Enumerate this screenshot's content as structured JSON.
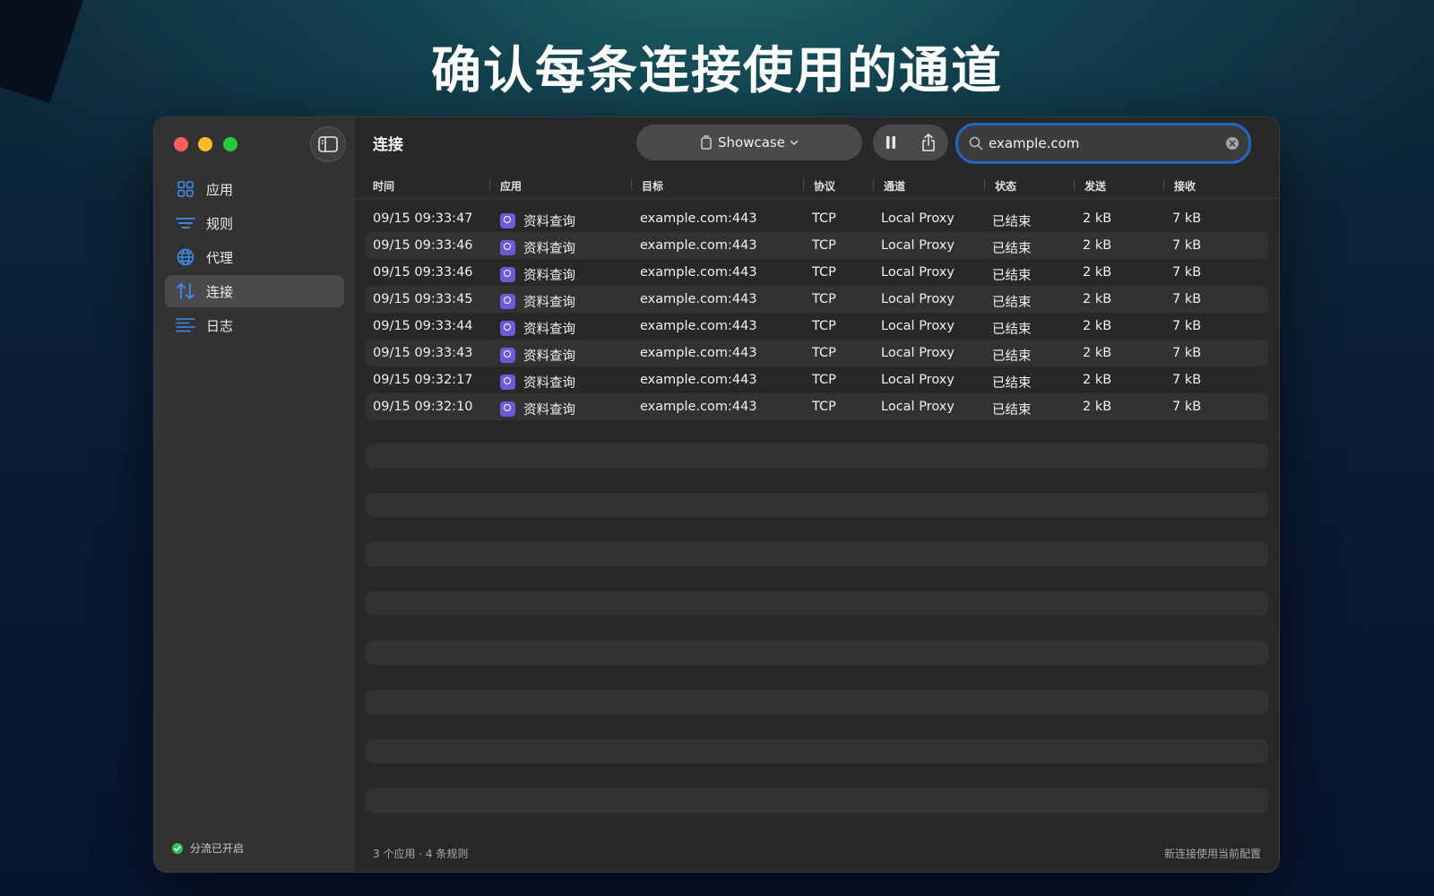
{
  "headline": "确认每条连接使用的通道",
  "sidebar": {
    "items": [
      {
        "label": "应用",
        "icon": "grid-icon"
      },
      {
        "label": "规则",
        "icon": "filter-lines-icon"
      },
      {
        "label": "代理",
        "icon": "globe-icon"
      },
      {
        "label": "连接",
        "icon": "arrows-up-down-icon",
        "active": true
      },
      {
        "label": "日志",
        "icon": "text-lines-icon"
      }
    ],
    "footer": "分流已开启"
  },
  "toolbar": {
    "title": "连接",
    "profile": "Showcase",
    "search_value": "example.com"
  },
  "table": {
    "columns": [
      "时间",
      "应用",
      "目标",
      "协议",
      "通道",
      "状态",
      "发送",
      "接收"
    ],
    "rows": [
      [
        "09/15 09:33:47",
        "资料查询",
        "example.com:443",
        "TCP",
        "Local Proxy",
        "已结束",
        "2 kB",
        "7 kB"
      ],
      [
        "09/15 09:33:46",
        "资料查询",
        "example.com:443",
        "TCP",
        "Local Proxy",
        "已结束",
        "2 kB",
        "7 kB"
      ],
      [
        "09/15 09:33:46",
        "资料查询",
        "example.com:443",
        "TCP",
        "Local Proxy",
        "已结束",
        "2 kB",
        "7 kB"
      ],
      [
        "09/15 09:33:45",
        "资料查询",
        "example.com:443",
        "TCP",
        "Local Proxy",
        "已结束",
        "2 kB",
        "7 kB"
      ],
      [
        "09/15 09:33:44",
        "资料查询",
        "example.com:443",
        "TCP",
        "Local Proxy",
        "已结束",
        "2 kB",
        "7 kB"
      ],
      [
        "09/15 09:33:43",
        "资料查询",
        "example.com:443",
        "TCP",
        "Local Proxy",
        "已结束",
        "2 kB",
        "7 kB"
      ],
      [
        "09/15 09:32:17",
        "资料查询",
        "example.com:443",
        "TCP",
        "Local Proxy",
        "已结束",
        "2 kB",
        "7 kB"
      ],
      [
        "09/15 09:32:10",
        "资料查询",
        "example.com:443",
        "TCP",
        "Local Proxy",
        "已结束",
        "2 kB",
        "7 kB"
      ]
    ]
  },
  "status": {
    "left": "3 个应用 · 4 条规则",
    "right": "新连接使用当前配置"
  },
  "colors": {
    "accent": "#1f67c8",
    "nav_icon": "#3d8ef0",
    "enabled_dot": "#30c45a",
    "app_icon": "#6b5bd6"
  }
}
